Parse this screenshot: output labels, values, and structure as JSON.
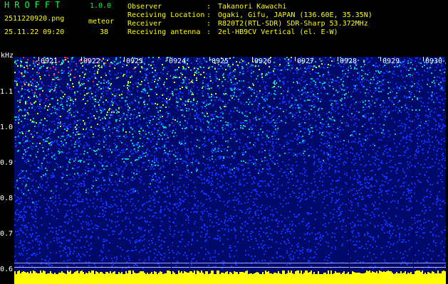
{
  "header": {
    "app_title": "HROFFT",
    "app_version": "1.0.0",
    "filename": "2511220920.png",
    "datetime": "25.11.22 09:20",
    "meteor_label": "meteor",
    "meteor_count": "38"
  },
  "info": [
    {
      "label": "Observer",
      "sep": ":",
      "value": "Takanori Kawachi"
    },
    {
      "label": "Receiving Location",
      "sep": ":",
      "value": "Ogaki, Gifu, JAPAN (136.60E, 35.35N)"
    },
    {
      "label": "Receiver",
      "sep": ":",
      "value": "R820T2(RTL-SDR) SDR-Sharp 53.372MHz"
    },
    {
      "label": "Receiving antenna",
      "sep": ":",
      "value": "2el-HB9CV Vertical (el. E-W)"
    }
  ],
  "spectrogram": {
    "y_unit": "kHz",
    "y_ticks": [
      "1.1",
      "1.0",
      "0.9",
      "0.8",
      "0.7",
      "0.6"
    ],
    "x_ticks": [
      "0921",
      "0922",
      "0923",
      "0924",
      "0925",
      "0926",
      "0927",
      "0928",
      "0929",
      "0930"
    ],
    "colors": {
      "background": "#000a6a",
      "low": "#1030ff",
      "mid": "#00c8c8",
      "high": "#c8ff00",
      "peak": "#ff2060",
      "baseline": "#ffff00"
    }
  }
}
